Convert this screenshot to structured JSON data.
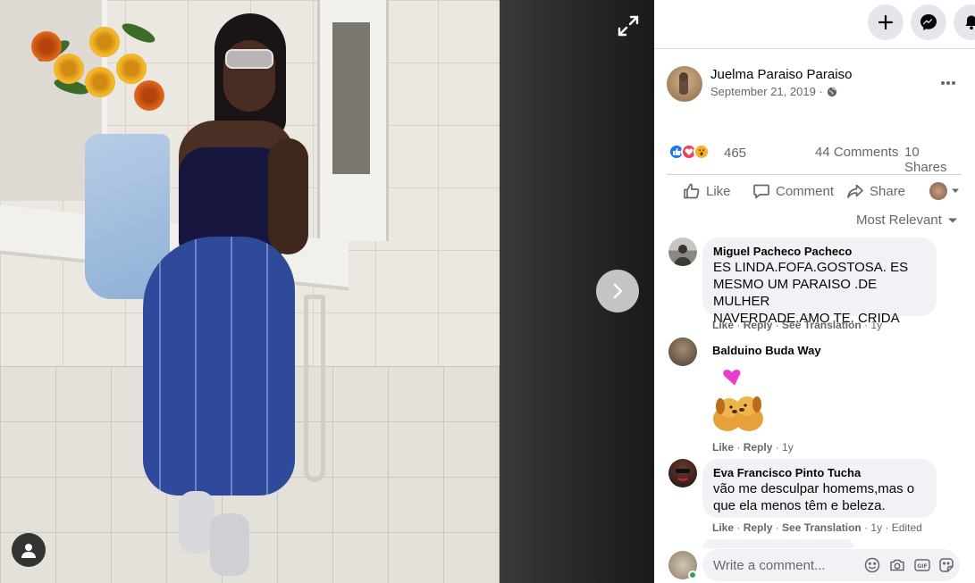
{
  "viewer": {
    "expand_icon": "expand-icon",
    "next_icon": "chevron-right-icon",
    "profile_icon": "user-icon"
  },
  "topbar": {
    "create_icon": "plus-icon",
    "messenger_icon": "messenger-icon",
    "notifications_icon": "bell-icon"
  },
  "post": {
    "author": "Juelma Paraiso Paraiso",
    "date": "September 21, 2019 ·",
    "privacy_icon": "globe-icon",
    "reactions_count": "465",
    "reaction_types": [
      "like",
      "love",
      "wow"
    ],
    "comments_count": "44 Comments",
    "shares_count": "10 Shares"
  },
  "actions": {
    "like": "Like",
    "comment": "Comment",
    "share": "Share"
  },
  "sort_label": "Most Relevant",
  "comments": [
    {
      "author": "Miguel Pacheco Pacheco",
      "lines": [
        "ES LINDA.FOFA.GOSTOSA. ES",
        "MESMO UM PARAISO .DE MULHER",
        "NAVERDADE.AMO TE. CRIDA"
      ],
      "like": "Like",
      "reply": "Reply",
      "translate": "See Translation",
      "time": "1y"
    },
    {
      "author": "Balduino Buda Way",
      "sticker": "puppies-heart-sticker",
      "like": "Like",
      "reply": "Reply",
      "time": "1y"
    },
    {
      "author": "Eva Francisco Pinto Tucha",
      "lines": [
        "vão me desculpar homems,mas o",
        "que ela menos têm e beleza."
      ],
      "like": "Like",
      "reply": "Reply",
      "translate": "See Translation",
      "time": "1y",
      "edited": "Edited"
    }
  ],
  "composer": {
    "placeholder": "Write a comment...",
    "tools": [
      "emoji-icon",
      "camera-icon",
      "gif-icon",
      "sticker-icon"
    ]
  },
  "colors": {
    "facebook_blue": "#1877f2",
    "love_red": "#f33e58",
    "wow_yellow": "#f7b125",
    "secondary_text": "#65676b",
    "bubble_bg": "#f0f2f5"
  }
}
